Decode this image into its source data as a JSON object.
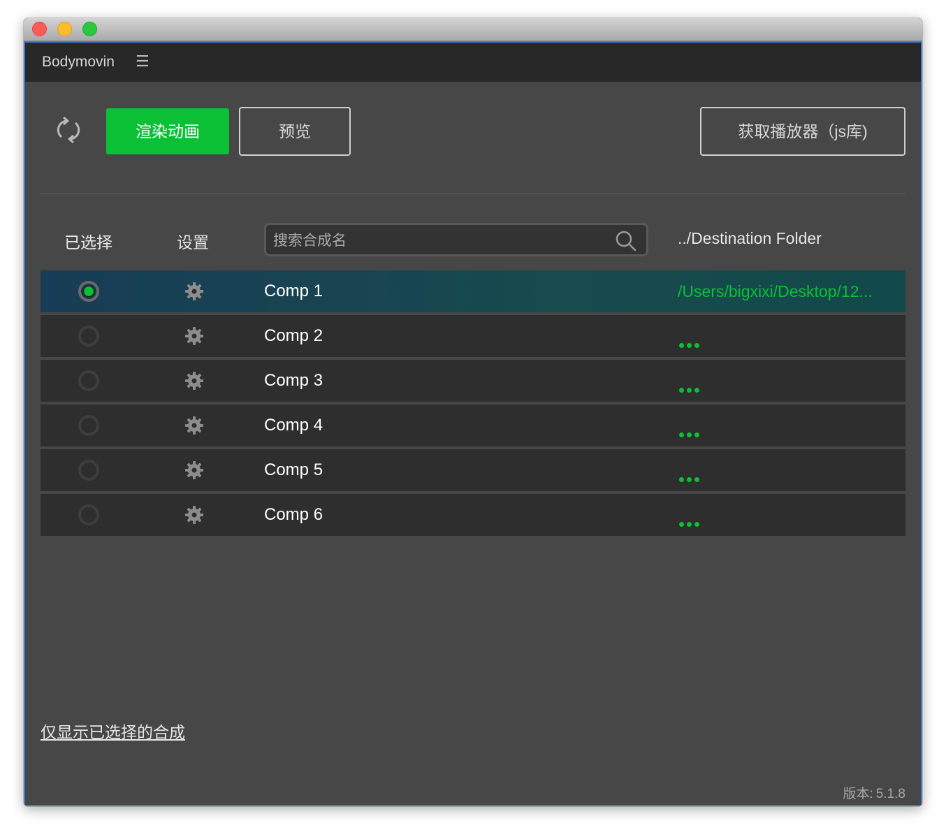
{
  "window": {
    "controls": [
      "close",
      "minimize",
      "maximize"
    ]
  },
  "panel": {
    "title": "Bodymovin",
    "menu_icon": "hamburger-menu-icon"
  },
  "toolbar": {
    "refresh_icon": "refresh-icon",
    "render_label": "渲染动画",
    "preview_label": "预览",
    "get_player_label": "获取播放器（js库)"
  },
  "table": {
    "col_selected": "已选择",
    "col_settings": "设置",
    "search_placeholder": "搜索合成名",
    "col_destination": "../Destination Folder",
    "rows": [
      {
        "name": "Comp 1",
        "selected": true,
        "destination": "/Users/bigxixi/Desktop/12..."
      },
      {
        "name": "Comp 2",
        "selected": false,
        "destination": "..."
      },
      {
        "name": "Comp 3",
        "selected": false,
        "destination": "..."
      },
      {
        "name": "Comp 4",
        "selected": false,
        "destination": "..."
      },
      {
        "name": "Comp 5",
        "selected": false,
        "destination": "..."
      },
      {
        "name": "Comp 6",
        "selected": false,
        "destination": "..."
      }
    ]
  },
  "footer": {
    "show_selected_only": "仅显示已选择的合成",
    "version_label": "版本:",
    "version_value": "5.1.8"
  },
  "colors": {
    "accent_green": "#0bc034",
    "selected_row": "#184a4e",
    "window_border": "#3e7bd6"
  }
}
